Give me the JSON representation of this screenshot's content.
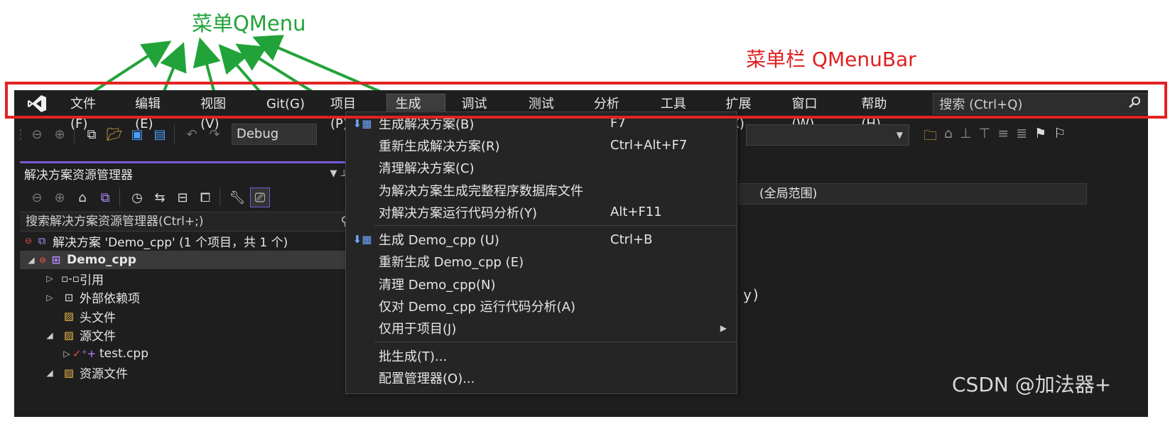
{
  "annotations": {
    "qmenu_label": "菜单QMenu",
    "qmenubar_label": "菜单栏 QMenuBar"
  },
  "menubar": {
    "items": [
      {
        "label": "文件(F)",
        "active": false
      },
      {
        "label": "编辑(E)",
        "active": false
      },
      {
        "label": "视图(V)",
        "active": false
      },
      {
        "label": "Git(G)",
        "active": false
      },
      {
        "label": "项目(P)",
        "active": false
      },
      {
        "label": "生成(B)",
        "active": true
      },
      {
        "label": "调试(D)",
        "active": false
      },
      {
        "label": "测试(S)",
        "active": false
      },
      {
        "label": "分析(N)",
        "active": false
      },
      {
        "label": "工具(T)",
        "active": false
      },
      {
        "label": "扩展(X)",
        "active": false
      },
      {
        "label": "窗口(W)",
        "active": false
      },
      {
        "label": "帮助(H)",
        "active": false
      }
    ],
    "search_placeholder": "搜索 (Ctrl+Q)"
  },
  "toolbar": {
    "config_value": "Debug"
  },
  "build_menu": {
    "items": [
      {
        "label": "生成解决方案(B)",
        "shortcut": "F7",
        "icon": "build-icon"
      },
      {
        "label": "重新生成解决方案(R)",
        "shortcut": "Ctrl+Alt+F7"
      },
      {
        "label": "清理解决方案(C)",
        "shortcut": ""
      },
      {
        "label": "为解决方案生成完整程序数据库文件",
        "shortcut": ""
      },
      {
        "label": "对解决方案运行代码分析(Y)",
        "shortcut": "Alt+F11"
      },
      {
        "separator": true
      },
      {
        "label": "生成 Demo_cpp (U)",
        "shortcut": "Ctrl+B",
        "icon": "build-icon"
      },
      {
        "label": "重新生成 Demo_cpp (E)",
        "shortcut": ""
      },
      {
        "label": "清理 Demo_cpp(N)",
        "shortcut": ""
      },
      {
        "label": "仅对 Demo_cpp 运行代码分析(A)",
        "shortcut": ""
      },
      {
        "label": "仅用于项目(J)",
        "shortcut": "",
        "submenu": true
      },
      {
        "separator": true
      },
      {
        "label": "批生成(T)...",
        "shortcut": ""
      },
      {
        "label": "配置管理器(O)...",
        "shortcut": ""
      }
    ]
  },
  "solution_explorer": {
    "title": "解决方案资源管理器",
    "search_placeholder": "搜索解决方案资源管理器(Ctrl+;)",
    "tree": [
      {
        "label": "解决方案 'Demo_cpp' (1 个项目，共 1 个)",
        "indent": 0,
        "twisty": "",
        "icon": "solution-icon"
      },
      {
        "label": "Demo_cpp",
        "indent": 0,
        "twisty": "◢",
        "icon": "project-icon",
        "selected": true
      },
      {
        "label": "引用",
        "indent": 1,
        "twisty": "▷",
        "icon": "references-icon"
      },
      {
        "label": "外部依赖项",
        "indent": 1,
        "twisty": "▷",
        "icon": "external-deps-icon"
      },
      {
        "label": "头文件",
        "indent": 1,
        "twisty": "",
        "icon": "filter-folder-icon"
      },
      {
        "label": "源文件",
        "indent": 1,
        "twisty": "◢",
        "icon": "filter-folder-icon"
      },
      {
        "label": "test.cpp",
        "indent": 2,
        "twisty": "▷",
        "icon": "cpp-file-icon"
      },
      {
        "label": "资源文件",
        "indent": 1,
        "twisty": "◢",
        "icon": "filter-folder-icon"
      }
    ]
  },
  "editor": {
    "scope_label": "(全局范围)",
    "code_fragment": "y)"
  },
  "watermark": "CSDN @加法器+"
}
